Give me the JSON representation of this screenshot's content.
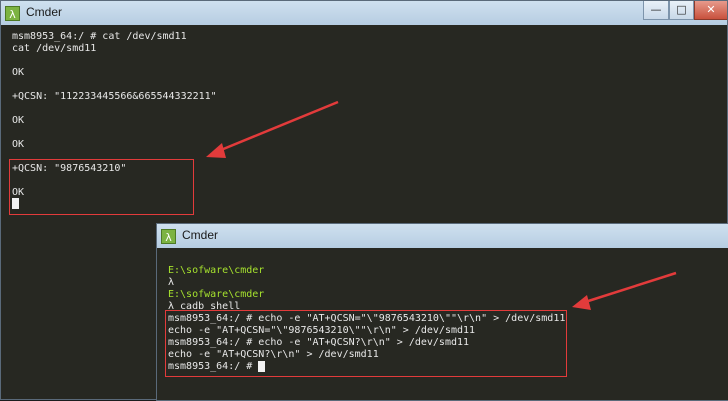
{
  "window1": {
    "title": "Cmder",
    "app_icon": "λ",
    "controls": {
      "minimize": "—",
      "maximize": "□",
      "close": "✕"
    },
    "lines": [
      "msm8953_64:/ # cat /dev/smd11",
      "cat /dev/smd11",
      "OK",
      "+QCSN: \"112233445566&665544332211\"",
      "OK",
      "OK",
      "+QCSN: \"9876543210\"",
      "OK"
    ]
  },
  "window2": {
    "title": "Cmder",
    "app_icon": "λ",
    "controls": {
      "minimize": "—",
      "maximize": "□",
      "close": "✕"
    },
    "lines": [
      "E:\\sofware\\cmder",
      "λ",
      "E:\\sofware\\cmder",
      "λ cadb shell",
      "msm8953_64:/ # echo -e \"AT+QCSN=\"\\\"9876543210\\\"\"\\r\\n\" > /dev/smd11",
      "echo -e \"AT+QCSN=\"\\\"9876543210\\\"\"\\r\\n\" > /dev/smd11",
      "msm8953_64:/ # echo -e \"AT+QCSN?\\r\\n\" > /dev/smd11",
      "echo -e \"AT+QCSN?\\r\\n\" > /dev/smd11",
      "msm8953_64:/ #"
    ]
  },
  "colors": {
    "terminal_bg": "#272822",
    "text": "#e8e8e8",
    "path_green": "#a6e22e",
    "annotation_red": "#e23b3b"
  }
}
